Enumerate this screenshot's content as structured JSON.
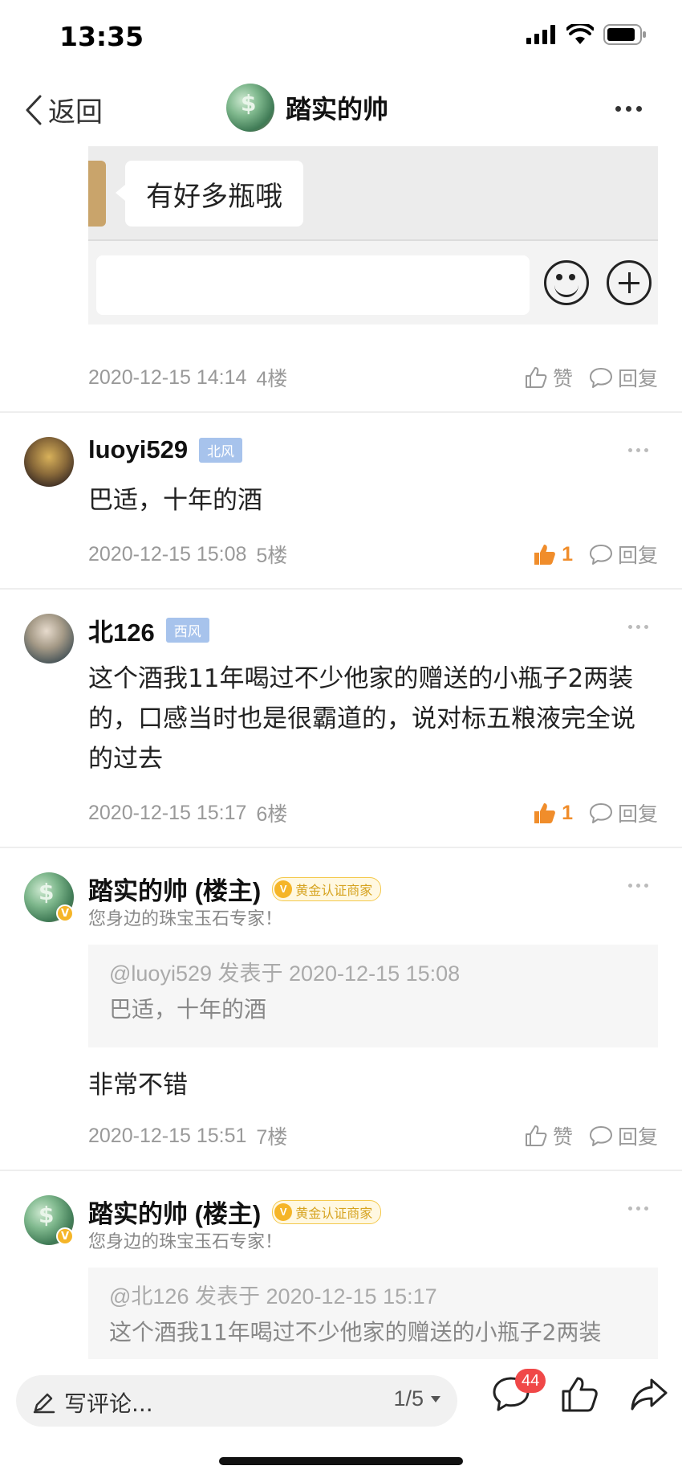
{
  "status_bar": {
    "time": "13:35"
  },
  "nav": {
    "back_label": "返回",
    "title": "踏实的帅"
  },
  "image": {
    "bubble_text": "有好多瓶哦"
  },
  "posts": [
    {
      "time": "2020-12-15 14:14",
      "floor": "4楼",
      "like_label": "赞",
      "reply_label": "回复"
    },
    {
      "username": "luoyi529",
      "tag": "北风",
      "body": "巴适，十年的酒",
      "time": "2020-12-15 15:08",
      "floor": "5楼",
      "like_count": "1",
      "reply_label": "回复"
    },
    {
      "username": "北126",
      "tag": "西风",
      "body": "这个酒我11年喝过不少他家的赠送的小瓶子2两装的，口感当时也是很霸道的，说对标五粮液完全说的过去",
      "time": "2020-12-15 15:17",
      "floor": "6楼",
      "like_count": "1",
      "reply_label": "回复"
    },
    {
      "username": "踏实的帅 (楼主)",
      "badge": "黄金认证商家",
      "signature": "您身边的珠宝玉石专家！",
      "quote_head": "@luoyi529 发表于 2020-12-15 15:08",
      "quote_text": "巴适，十年的酒",
      "body": "非常不错",
      "time": "2020-12-15 15:51",
      "floor": "7楼",
      "like_label": "赞",
      "reply_label": "回复"
    },
    {
      "username": "踏实的帅 (楼主)",
      "badge": "黄金认证商家",
      "signature": "您身边的珠宝玉石专家！",
      "quote_head": "@北126 发表于 2020-12-15 15:17",
      "quote_text": "这个酒我11年喝过不少他家的赠送的小瓶子2两装"
    }
  ],
  "bottom_bar": {
    "comment_placeholder": "写评论...",
    "page_indicator": "1/5",
    "comment_count": "44"
  },
  "colors": {
    "accent_orange": "#f08d2b",
    "badge_red": "#f04848",
    "gold": "#f5b528",
    "tag_blue": "#a7c3ec"
  }
}
